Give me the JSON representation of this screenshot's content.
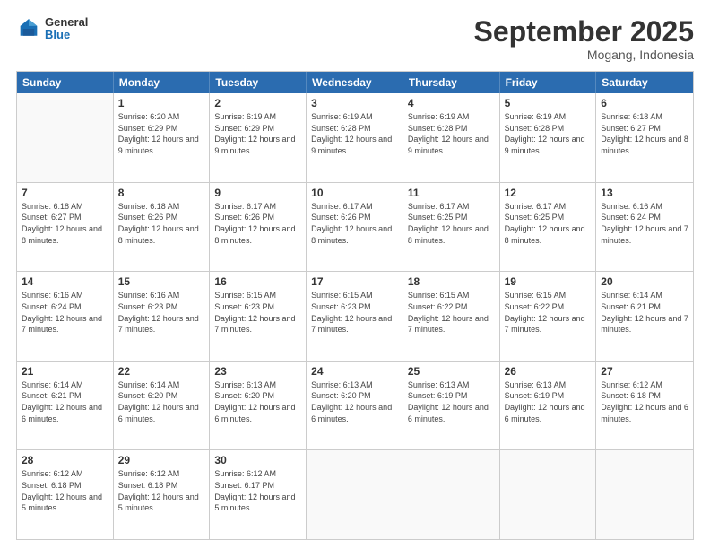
{
  "header": {
    "logo_general": "General",
    "logo_blue": "Blue",
    "month_title": "September 2025",
    "location": "Mogang, Indonesia"
  },
  "weekdays": [
    "Sunday",
    "Monday",
    "Tuesday",
    "Wednesday",
    "Thursday",
    "Friday",
    "Saturday"
  ],
  "rows": [
    [
      {
        "day": "",
        "empty": true
      },
      {
        "day": "1",
        "sunrise": "6:20 AM",
        "sunset": "6:29 PM",
        "daylight": "12 hours and 9 minutes."
      },
      {
        "day": "2",
        "sunrise": "6:19 AM",
        "sunset": "6:29 PM",
        "daylight": "12 hours and 9 minutes."
      },
      {
        "day": "3",
        "sunrise": "6:19 AM",
        "sunset": "6:28 PM",
        "daylight": "12 hours and 9 minutes."
      },
      {
        "day": "4",
        "sunrise": "6:19 AM",
        "sunset": "6:28 PM",
        "daylight": "12 hours and 9 minutes."
      },
      {
        "day": "5",
        "sunrise": "6:19 AM",
        "sunset": "6:28 PM",
        "daylight": "12 hours and 9 minutes."
      },
      {
        "day": "6",
        "sunrise": "6:18 AM",
        "sunset": "6:27 PM",
        "daylight": "12 hours and 8 minutes."
      }
    ],
    [
      {
        "day": "7",
        "sunrise": "6:18 AM",
        "sunset": "6:27 PM",
        "daylight": "12 hours and 8 minutes."
      },
      {
        "day": "8",
        "sunrise": "6:18 AM",
        "sunset": "6:26 PM",
        "daylight": "12 hours and 8 minutes."
      },
      {
        "day": "9",
        "sunrise": "6:17 AM",
        "sunset": "6:26 PM",
        "daylight": "12 hours and 8 minutes."
      },
      {
        "day": "10",
        "sunrise": "6:17 AM",
        "sunset": "6:26 PM",
        "daylight": "12 hours and 8 minutes."
      },
      {
        "day": "11",
        "sunrise": "6:17 AM",
        "sunset": "6:25 PM",
        "daylight": "12 hours and 8 minutes."
      },
      {
        "day": "12",
        "sunrise": "6:17 AM",
        "sunset": "6:25 PM",
        "daylight": "12 hours and 8 minutes."
      },
      {
        "day": "13",
        "sunrise": "6:16 AM",
        "sunset": "6:24 PM",
        "daylight": "12 hours and 7 minutes."
      }
    ],
    [
      {
        "day": "14",
        "sunrise": "6:16 AM",
        "sunset": "6:24 PM",
        "daylight": "12 hours and 7 minutes."
      },
      {
        "day": "15",
        "sunrise": "6:16 AM",
        "sunset": "6:23 PM",
        "daylight": "12 hours and 7 minutes."
      },
      {
        "day": "16",
        "sunrise": "6:15 AM",
        "sunset": "6:23 PM",
        "daylight": "12 hours and 7 minutes."
      },
      {
        "day": "17",
        "sunrise": "6:15 AM",
        "sunset": "6:23 PM",
        "daylight": "12 hours and 7 minutes."
      },
      {
        "day": "18",
        "sunrise": "6:15 AM",
        "sunset": "6:22 PM",
        "daylight": "12 hours and 7 minutes."
      },
      {
        "day": "19",
        "sunrise": "6:15 AM",
        "sunset": "6:22 PM",
        "daylight": "12 hours and 7 minutes."
      },
      {
        "day": "20",
        "sunrise": "6:14 AM",
        "sunset": "6:21 PM",
        "daylight": "12 hours and 7 minutes."
      }
    ],
    [
      {
        "day": "21",
        "sunrise": "6:14 AM",
        "sunset": "6:21 PM",
        "daylight": "12 hours and 6 minutes."
      },
      {
        "day": "22",
        "sunrise": "6:14 AM",
        "sunset": "6:20 PM",
        "daylight": "12 hours and 6 minutes."
      },
      {
        "day": "23",
        "sunrise": "6:13 AM",
        "sunset": "6:20 PM",
        "daylight": "12 hours and 6 minutes."
      },
      {
        "day": "24",
        "sunrise": "6:13 AM",
        "sunset": "6:20 PM",
        "daylight": "12 hours and 6 minutes."
      },
      {
        "day": "25",
        "sunrise": "6:13 AM",
        "sunset": "6:19 PM",
        "daylight": "12 hours and 6 minutes."
      },
      {
        "day": "26",
        "sunrise": "6:13 AM",
        "sunset": "6:19 PM",
        "daylight": "12 hours and 6 minutes."
      },
      {
        "day": "27",
        "sunrise": "6:12 AM",
        "sunset": "6:18 PM",
        "daylight": "12 hours and 6 minutes."
      }
    ],
    [
      {
        "day": "28",
        "sunrise": "6:12 AM",
        "sunset": "6:18 PM",
        "daylight": "12 hours and 5 minutes."
      },
      {
        "day": "29",
        "sunrise": "6:12 AM",
        "sunset": "6:18 PM",
        "daylight": "12 hours and 5 minutes."
      },
      {
        "day": "30",
        "sunrise": "6:12 AM",
        "sunset": "6:17 PM",
        "daylight": "12 hours and 5 minutes."
      },
      {
        "day": "",
        "empty": true
      },
      {
        "day": "",
        "empty": true
      },
      {
        "day": "",
        "empty": true
      },
      {
        "day": "",
        "empty": true
      }
    ]
  ]
}
